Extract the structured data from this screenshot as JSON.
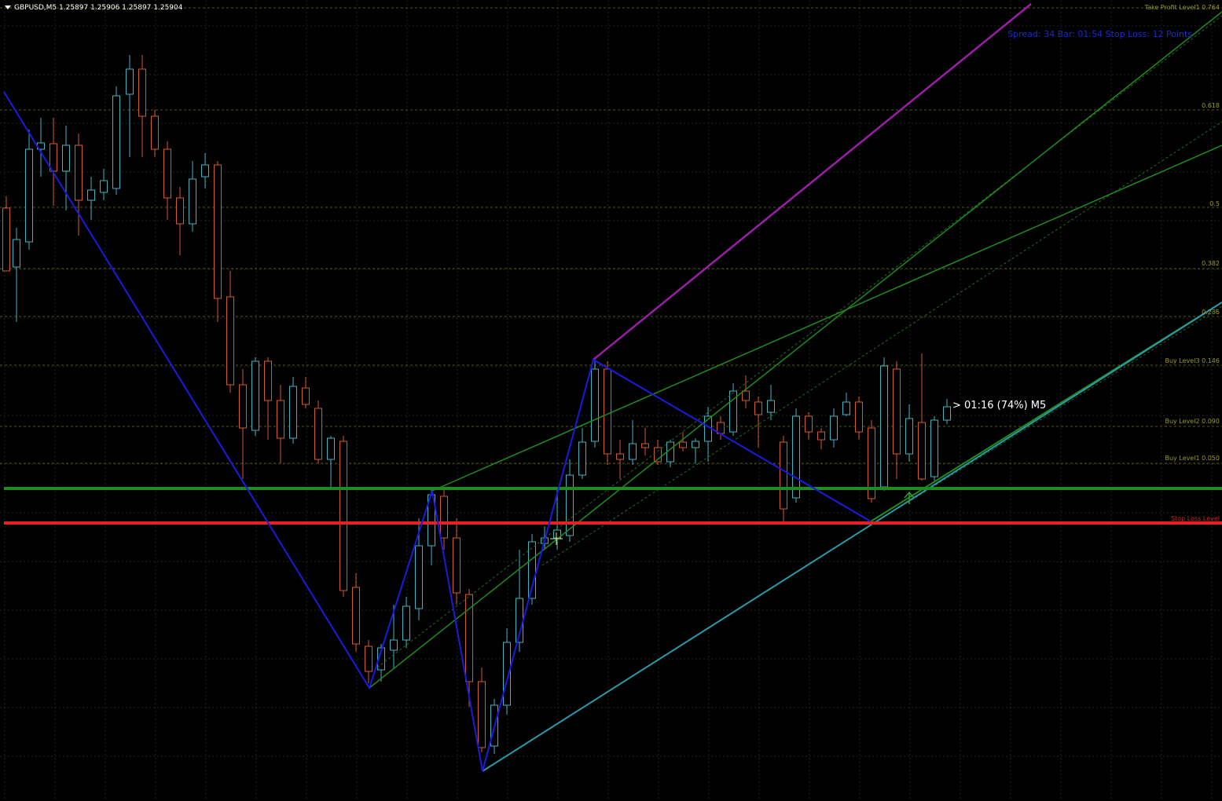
{
  "header": {
    "symbol_line": "GBPUSD,M5  1.25897 1.25906 1.25897 1.25904"
  },
  "info_line": "Spread: 34 Bar: 01:54 Stop Loss: 12 Points",
  "timer_label": "> 01:16 (74%) M5",
  "level_labels": {
    "take_profit": "Take Profit Level1 0.764",
    "fib_0618": "0.618",
    "fib_05": "0.5",
    "fib_0382": "0.382",
    "fib_0236": "0.236",
    "buy_level3": "Buy Level3 0.146",
    "buy_level2": "Buy Level2 0.090",
    "buy_level1": "Buy Level1 0.050",
    "stop_loss": "Stop Loss Level"
  },
  "colors": {
    "background": "#000000",
    "bull": "#3fb5bf",
    "bear": "#d45a2a",
    "grid": "#1e2a1e",
    "zigzag": "#1a1ae0",
    "buy_line": "#1e8c1e",
    "stop_line": "#e82020",
    "magenta": "#9b1ea8",
    "channel": "#1e8c1e",
    "teal": "#2a9aa8",
    "level_dash": "#6e6e1e"
  },
  "chart_data": {
    "type": "candlestick",
    "symbol": "GBPUSD",
    "timeframe": "M5",
    "ohlc_header": {
      "open": 1.25897,
      "high": 1.25906,
      "low": 1.25897,
      "close": 1.25904
    },
    "levels": [
      {
        "name": "Take Profit Level1",
        "ratio": 0.764
      },
      {
        "name": "",
        "ratio": 0.618
      },
      {
        "name": "",
        "ratio": 0.5
      },
      {
        "name": "",
        "ratio": 0.382
      },
      {
        "name": "",
        "ratio": 0.236
      },
      {
        "name": "Buy Level3",
        "ratio": 0.146
      },
      {
        "name": "Buy Level2",
        "ratio": 0.09
      },
      {
        "name": "Buy Level1",
        "ratio": 0.05
      },
      {
        "name": "Stop Loss Level",
        "ratio": 0
      }
    ],
    "grid": true
  }
}
